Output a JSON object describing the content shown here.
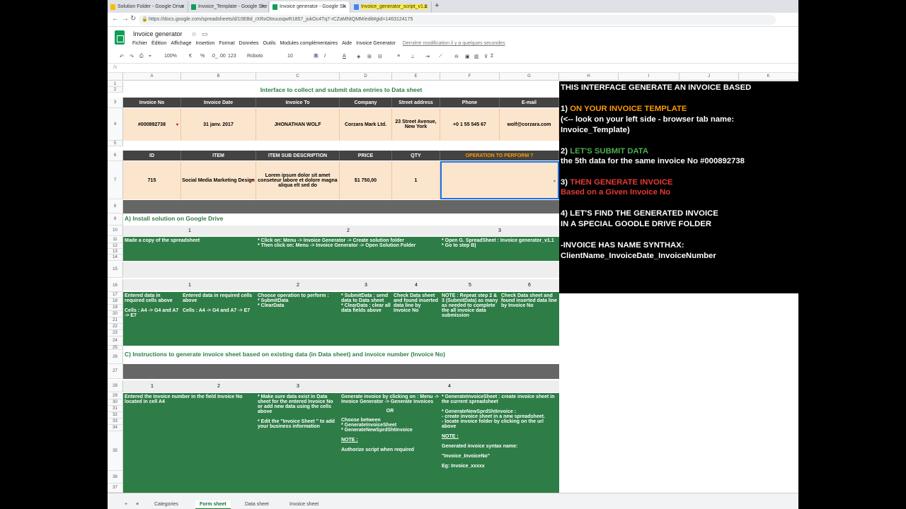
{
  "browser": {
    "tabs": [
      "Solution Folder - Google Drive",
      "Invoice_Template - Google She",
      "Invoice generator - Google Sh",
      "Invoice_generator_script_v1.1"
    ],
    "url": "https://docs.google.com/spreadsheets/d/10EBd_rXRxOtnuusqwR1857_jukOc4Tq7-rCZaMNtQMM/edit#gid=1463124175"
  },
  "doc": {
    "title": "Invoice generator",
    "menus": [
      "Fichier",
      "Édition",
      "Affichage",
      "Insertion",
      "Format",
      "Données",
      "Outils",
      "Modules complémentaires",
      "Aide",
      "Invoice Generator"
    ],
    "last_edit": "Dernière modification il y a quelques secondes"
  },
  "toolbar": {
    "zoom": "100%",
    "euro": "€",
    "pct": "%",
    "dec": ".0_",
    "dec2": ".00",
    "num": "123",
    "font": "Roboto",
    "size": "10",
    "bold": "B",
    "italic": "I",
    "fx": "fx"
  },
  "cols": [
    "A",
    "B",
    "C",
    "D",
    "E",
    "F",
    "G",
    "H",
    "I",
    "J",
    "K"
  ],
  "sheet": {
    "interface_title": "Interface to collect and submit data entries to Data sheet",
    "h1": [
      "Invoice No",
      "Invoice Date",
      "Invoice To",
      "Company",
      "Street address",
      "Phone",
      "E-mail"
    ],
    "r1": [
      "#000892738",
      "31 janv. 2017",
      "JHONATHAN WOLF",
      "Corzara Mark Ltd.",
      "23 Street Avenue, New York",
      "+0  1 55 545 67",
      "wolf@corzara.com"
    ],
    "h2": [
      "ID",
      "ITEM",
      "ITEM SUB DESCRIPTION",
      "PRICE",
      "QTY",
      "OPERATION TO PERFORM  ?"
    ],
    "r2": [
      "715",
      "Social Media Marketing Design",
      "Lorem ipsum dolor sit amet conseteur labore et dolore magna aliqua elt sed do",
      "$1 750,00",
      "1",
      ""
    ],
    "secA": "A) Install solution on Google Drive",
    "a_nums": [
      "1",
      "2",
      "3"
    ],
    "a1": "Made a copy of the spreadsheet",
    "a2a": "* Click on: Menu -> Invoice Generator -> Create solution folder",
    "a2b": "* Then click on:  Menu -> Invoice Generator -> Open Solution Folder",
    "a3a": "* Open G. SpreadSheet : Invoice generator_v1.1",
    "a3b": "* Go to step B)",
    "b_nums": [
      "1",
      "2",
      "3",
      "4",
      "5",
      "6"
    ],
    "b1": "Entered data in required cells above",
    "b1b": "Cells : A4 -> G4 and A7 -> E7",
    "b2": "Entered data in required cells above",
    "b2b": "Cells : A4 -> G4 and A7 -> E7",
    "b3": "Choose operation to perform :",
    "b3b": "* SubmitData",
    "b3c": "* ClearData",
    "b4": "* SubmitData : send data to Data sheet",
    "b4b": "* ClearData : clear all data fields above",
    "b5": "Check Data sheet and found inserted data line by Invoice No",
    "b6": "NOTE : Repeat step 2 & 3 (SubmitData) as many as needed to complete the all invoice data submission",
    "b7": "Check Data sheet and found inserted data line by Invoice No",
    "secC": "C) Instructions to generate invoice sheet based on existing data (in Data sheet) and invoice number (Invoice No)",
    "c_nums": [
      "1",
      "2",
      "3",
      "4"
    ],
    "c1": "Entered  the Invoice number in the field Invoice No  located in cell A4",
    "c3a": "* Make sure data exist in Data sheet  for the entered Invoice No or add new data using the cells above",
    "c3b": "* Edit the \"Invoice Sheet \"  to add your business information",
    "c4a": "Generate invoice by clicking on : Menu -> Invoice Generator -> Generate Invoices",
    "c4or": "OR",
    "c4b": "Choose between",
    "c4c": "*  GenerateInvoiceSheet",
    "c4d": "*  GenerateNewSprdShtInvoice",
    "c4note": "NOTE :",
    "c4e": "Authorize script when required",
    "c5a": "* GenerateInvoiceSheet : create invoice sheet in the current spreadsheet",
    "c5b": "* GenerateNewSprdShtInvoice :",
    "c5c": "- create invoice sheet in a new spreadsheet.",
    "c5d": "- locate invoice folder by clicking on the url above",
    "c5note": "NOTE :",
    "c5e": "Generated invoice syntax name:",
    "c5f": "\"Invoice_InvoiceNo\"",
    "c5g": "Eg: Invoice_xxxxx"
  },
  "sheet_tabs": [
    "Categories",
    "Form sheet",
    "Data sheet",
    "Invoice sheet"
  ],
  "panel": {
    "l1": "THIS INTERFACE GENERATE AN INVOICE BASED",
    "l2a": "1) ",
    "l2b": "ON YOUR INVOICE TEMPLATE",
    "l3": "(<-- look on your left side - browser tab name:",
    "l4": " Invoice_Template)",
    "l5a": "2) ",
    "l5b": "LET'S SUBMIT DATA",
    "l6": "the 5th data for the same invoice No #000892738",
    "l7a": "3) ",
    "l7b": "THEN GENERATE INVOICE",
    "l8": "Based on a  Given  Invoice No",
    "l9": "4) LET'S FIND THE GENERATED INVOICE",
    "l10": "IN A SPECIAL GOODLE DRIVE FOLDER",
    "l11": "-INVOICE HAS NAME SYNTHAX:",
    "l12": "ClientName_InvoiceDate_InvoiceNumber"
  }
}
